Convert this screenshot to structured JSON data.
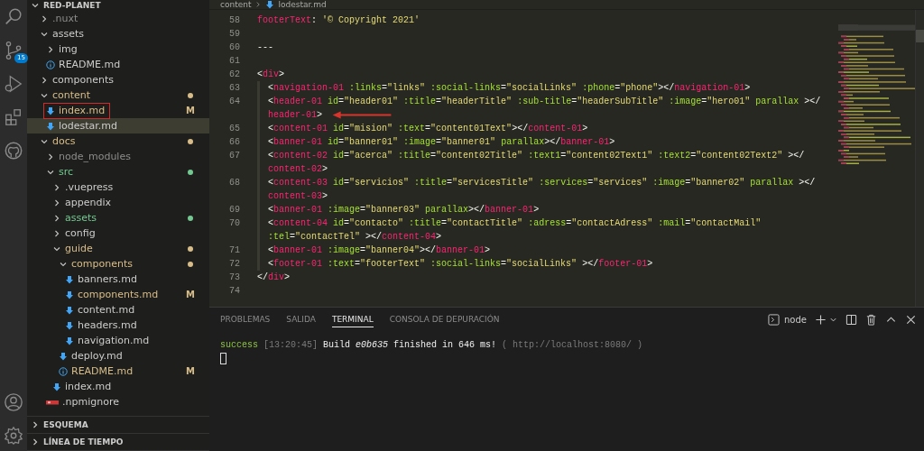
{
  "activity_bar": {
    "badge": "15"
  },
  "sidebar": {
    "title": "RED-PLANET",
    "tree": [
      {
        "name": ".nuxt",
        "kind": "folder",
        "expanded": false,
        "color": "#8c8c8c",
        "dot": false,
        "selected": false
      },
      {
        "name": "assets",
        "kind": "folder",
        "expanded": true,
        "color": "#cccccc",
        "dot": false,
        "selected": false,
        "children": [
          {
            "name": "img",
            "kind": "folder",
            "expanded": false,
            "color": "#cccccc",
            "dot": false,
            "selected": false
          },
          {
            "name": "README.md",
            "kind": "info",
            "color": "#cccccc",
            "selected": false
          }
        ]
      },
      {
        "name": "components",
        "kind": "folder",
        "expanded": false,
        "color": "#cccccc",
        "dot": false,
        "selected": false
      },
      {
        "name": "content",
        "kind": "folder",
        "expanded": true,
        "color": "#d8bd8a",
        "dot": true,
        "selected": false,
        "children": [
          {
            "name": "index.md",
            "kind": "markdown",
            "color": "#d8bd8a",
            "badge": "M",
            "marked": true,
            "selected": false
          },
          {
            "name": "lodestar.md",
            "kind": "markdown",
            "color": "#cccccc",
            "selected": true
          }
        ]
      },
      {
        "name": "docs",
        "kind": "folder",
        "expanded": true,
        "color": "#d8bd8a",
        "dot": true,
        "selected": false,
        "children": [
          {
            "name": "node_modules",
            "kind": "folder",
            "expanded": false,
            "color": "#8c8c8c",
            "dot": false,
            "selected": false
          },
          {
            "name": "src",
            "kind": "folder",
            "expanded": true,
            "color": "#73c991",
            "dot": true,
            "selected": false,
            "children": [
              {
                "name": ".vuepress",
                "kind": "folder",
                "expanded": false,
                "color": "#cccccc",
                "dot": false,
                "selected": false
              },
              {
                "name": "appendix",
                "kind": "folder",
                "expanded": false,
                "color": "#cccccc",
                "dot": false,
                "selected": false
              },
              {
                "name": "assets",
                "kind": "folder",
                "expanded": false,
                "color": "#73c991",
                "dot": true,
                "selected": false
              },
              {
                "name": "config",
                "kind": "folder",
                "expanded": false,
                "color": "#cccccc",
                "dot": false,
                "selected": false
              },
              {
                "name": "guide",
                "kind": "folder",
                "expanded": true,
                "color": "#d8bd8a",
                "dot": true,
                "selected": false,
                "children": [
                  {
                    "name": "components",
                    "kind": "folder",
                    "expanded": true,
                    "color": "#d8bd8a",
                    "dot": true,
                    "selected": false,
                    "children": [
                      {
                        "name": "banners.md",
                        "kind": "markdown",
                        "color": "#cccccc",
                        "selected": false
                      },
                      {
                        "name": "components.md",
                        "kind": "markdown",
                        "color": "#d8bd8a",
                        "badge": "M",
                        "selected": false
                      },
                      {
                        "name": "content.md",
                        "kind": "markdown",
                        "color": "#cccccc",
                        "selected": false
                      },
                      {
                        "name": "headers.md",
                        "kind": "markdown",
                        "color": "#cccccc",
                        "selected": false
                      },
                      {
                        "name": "navigation.md",
                        "kind": "markdown",
                        "color": "#cccccc",
                        "selected": false
                      }
                    ]
                  },
                  {
                    "name": "deploy.md",
                    "kind": "markdown",
                    "color": "#cccccc",
                    "selected": false
                  },
                  {
                    "name": "README.md",
                    "kind": "info",
                    "color": "#d8bd8a",
                    "badge": "M",
                    "selected": false
                  }
                ]
              },
              {
                "name": "index.md",
                "kind": "markdown",
                "color": "#cccccc",
                "selected": false
              }
            ]
          },
          {
            "name": ".npmignore",
            "kind": "npm",
            "color": "#cccccc",
            "selected": false
          }
        ]
      }
    ],
    "sections": [
      {
        "label": "ESQUEMA",
        "expanded": false
      },
      {
        "label": "LÍNEA DE TIEMPO",
        "expanded": false
      }
    ]
  },
  "editor": {
    "breadcrumb": [
      "content",
      "lodestar.md"
    ],
    "lines": [
      {
        "number": "58",
        "indented": false,
        "tokens": [
          {
            "kind": "key",
            "text": "footerText"
          },
          {
            "kind": "punct",
            "text": ": "
          },
          {
            "kind": "string",
            "text": "'© Copyright 2021'"
          }
        ]
      },
      {
        "number": "59",
        "indented": false
      },
      {
        "number": "60",
        "indented": false,
        "tokens": [
          {
            "kind": "punct",
            "text": "---"
          }
        ]
      },
      {
        "number": "61",
        "indented": false
      },
      {
        "number": "62",
        "indented": false,
        "tokens": [
          {
            "kind": "punct",
            "text": "<"
          },
          {
            "kind": "tag",
            "text": "div"
          },
          {
            "kind": "punct",
            "text": ">"
          }
        ]
      },
      {
        "number": "63",
        "indented": true,
        "tokens": [
          {
            "kind": "punct",
            "text": "<"
          },
          {
            "kind": "tag",
            "text": "navigation-01"
          },
          {
            "kind": "attr",
            "text": " :links"
          },
          {
            "kind": "punct",
            "text": "="
          },
          {
            "kind": "string",
            "text": "\"links\""
          },
          {
            "kind": "attr",
            "text": " :social-links"
          },
          {
            "kind": "punct",
            "text": "="
          },
          {
            "kind": "string",
            "text": "\"socialLinks\""
          },
          {
            "kind": "attr",
            "text": " :phone"
          },
          {
            "kind": "punct",
            "text": "="
          },
          {
            "kind": "string",
            "text": "\"phone\""
          },
          {
            "kind": "punct",
            "text": "></"
          },
          {
            "kind": "tag",
            "text": "navigation-01"
          },
          {
            "kind": "punct",
            "text": ">"
          }
        ]
      },
      {
        "number": "64",
        "indented": true,
        "tokens": [
          {
            "kind": "punct",
            "text": "<"
          },
          {
            "kind": "tag",
            "text": "header-01"
          },
          {
            "kind": "attr",
            "text": " id"
          },
          {
            "kind": "punct",
            "text": "="
          },
          {
            "kind": "string",
            "text": "\"header01\""
          },
          {
            "kind": "attr",
            "text": " :title"
          },
          {
            "kind": "punct",
            "text": "="
          },
          {
            "kind": "string",
            "text": "\"headerTitle\""
          },
          {
            "kind": "attr",
            "text": " :sub-title"
          },
          {
            "kind": "punct",
            "text": "="
          },
          {
            "kind": "string",
            "text": "\"headerSubTitle\""
          },
          {
            "kind": "attr",
            "text": " :image"
          },
          {
            "kind": "punct",
            "text": "="
          },
          {
            "kind": "string",
            "text": "\"hero01\""
          },
          {
            "kind": "attr",
            "text": " parallax"
          },
          {
            "kind": "punct",
            "text": " ></"
          }
        ]
      },
      {
        "indented": true,
        "marked": true,
        "tokens": [
          {
            "kind": "tag",
            "text": "header-01"
          },
          {
            "kind": "punct",
            "text": ">"
          }
        ]
      },
      {
        "number": "65",
        "indented": true,
        "tokens": [
          {
            "kind": "punct",
            "text": "<"
          },
          {
            "kind": "tag",
            "text": "content-01"
          },
          {
            "kind": "attr",
            "text": " id"
          },
          {
            "kind": "punct",
            "text": "="
          },
          {
            "kind": "string",
            "text": "\"mision\""
          },
          {
            "kind": "attr",
            "text": " :text"
          },
          {
            "kind": "punct",
            "text": "="
          },
          {
            "kind": "string",
            "text": "\"content01Text\""
          },
          {
            "kind": "punct",
            "text": "></"
          },
          {
            "kind": "tag",
            "text": "content-01"
          },
          {
            "kind": "punct",
            "text": ">"
          }
        ]
      },
      {
        "number": "66",
        "indented": true,
        "tokens": [
          {
            "kind": "punct",
            "text": "<"
          },
          {
            "kind": "tag",
            "text": "banner-01"
          },
          {
            "kind": "attr",
            "text": " id"
          },
          {
            "kind": "punct",
            "text": "="
          },
          {
            "kind": "string",
            "text": "\"banner01\""
          },
          {
            "kind": "attr",
            "text": " :image"
          },
          {
            "kind": "punct",
            "text": "="
          },
          {
            "kind": "string",
            "text": "\"banner01\""
          },
          {
            "kind": "attr",
            "text": " parallax"
          },
          {
            "kind": "punct",
            "text": "></"
          },
          {
            "kind": "tag",
            "text": "banner-01"
          },
          {
            "kind": "punct",
            "text": ">"
          }
        ]
      },
      {
        "number": "67",
        "indented": true,
        "tokens": [
          {
            "kind": "punct",
            "text": "<"
          },
          {
            "kind": "tag",
            "text": "content-02"
          },
          {
            "kind": "attr",
            "text": " id"
          },
          {
            "kind": "punct",
            "text": "="
          },
          {
            "kind": "string",
            "text": "\"acerca\""
          },
          {
            "kind": "attr",
            "text": " :title"
          },
          {
            "kind": "punct",
            "text": "="
          },
          {
            "kind": "string",
            "text": "\"content02Title\""
          },
          {
            "kind": "attr",
            "text": " :text1"
          },
          {
            "kind": "punct",
            "text": "="
          },
          {
            "kind": "string",
            "text": "\"content02Text1\""
          },
          {
            "kind": "attr",
            "text": " :text2"
          },
          {
            "kind": "punct",
            "text": "="
          },
          {
            "kind": "string",
            "text": "\"content02Text2\""
          },
          {
            "kind": "punct",
            "text": " ></"
          }
        ]
      },
      {
        "indented": true,
        "tokens": [
          {
            "kind": "tag",
            "text": "content-02"
          },
          {
            "kind": "punct",
            "text": ">"
          }
        ]
      },
      {
        "number": "68",
        "indented": true,
        "tokens": [
          {
            "kind": "punct",
            "text": "<"
          },
          {
            "kind": "tag",
            "text": "content-03"
          },
          {
            "kind": "attr",
            "text": " id"
          },
          {
            "kind": "punct",
            "text": "="
          },
          {
            "kind": "string",
            "text": "\"servicios\""
          },
          {
            "kind": "attr",
            "text": " :title"
          },
          {
            "kind": "punct",
            "text": "="
          },
          {
            "kind": "string",
            "text": "\"servicesTitle\""
          },
          {
            "kind": "attr",
            "text": " :services"
          },
          {
            "kind": "punct",
            "text": "="
          },
          {
            "kind": "string",
            "text": "\"services\""
          },
          {
            "kind": "attr",
            "text": " :image"
          },
          {
            "kind": "punct",
            "text": "="
          },
          {
            "kind": "string",
            "text": "\"banner02\""
          },
          {
            "kind": "attr",
            "text": " parallax"
          },
          {
            "kind": "punct",
            "text": " ></"
          }
        ]
      },
      {
        "indented": true,
        "tokens": [
          {
            "kind": "tag",
            "text": "content-03"
          },
          {
            "kind": "punct",
            "text": ">"
          }
        ]
      },
      {
        "number": "69",
        "indented": true,
        "tokens": [
          {
            "kind": "punct",
            "text": "<"
          },
          {
            "kind": "tag",
            "text": "banner-01"
          },
          {
            "kind": "attr",
            "text": " :image"
          },
          {
            "kind": "punct",
            "text": "="
          },
          {
            "kind": "string",
            "text": "\"banner03\""
          },
          {
            "kind": "attr",
            "text": " parallax"
          },
          {
            "kind": "punct",
            "text": "></"
          },
          {
            "kind": "tag",
            "text": "banner-01"
          },
          {
            "kind": "punct",
            "text": ">"
          }
        ]
      },
      {
        "number": "70",
        "indented": true,
        "tokens": [
          {
            "kind": "punct",
            "text": "<"
          },
          {
            "kind": "tag",
            "text": "content-04"
          },
          {
            "kind": "attr",
            "text": " id"
          },
          {
            "kind": "punct",
            "text": "="
          },
          {
            "kind": "string",
            "text": "\"contacto\""
          },
          {
            "kind": "attr",
            "text": " :title"
          },
          {
            "kind": "punct",
            "text": "="
          },
          {
            "kind": "string",
            "text": "\"contactTitle\""
          },
          {
            "kind": "attr",
            "text": " :adress"
          },
          {
            "kind": "punct",
            "text": "="
          },
          {
            "kind": "string",
            "text": "\"contactAdress\""
          },
          {
            "kind": "attr",
            "text": " :mail"
          },
          {
            "kind": "punct",
            "text": "="
          },
          {
            "kind": "string",
            "text": "\"contactMail\""
          }
        ]
      },
      {
        "indented": true,
        "tokens": [
          {
            "kind": "attr",
            "text": ":tel"
          },
          {
            "kind": "punct",
            "text": "="
          },
          {
            "kind": "string",
            "text": "\"contactTel\""
          },
          {
            "kind": "punct",
            "text": " ></"
          },
          {
            "kind": "tag",
            "text": "content-04"
          },
          {
            "kind": "punct",
            "text": ">"
          }
        ]
      },
      {
        "number": "71",
        "indented": true,
        "tokens": [
          {
            "kind": "punct",
            "text": "<"
          },
          {
            "kind": "tag",
            "text": "banner-01"
          },
          {
            "kind": "attr",
            "text": " :image"
          },
          {
            "kind": "punct",
            "text": "="
          },
          {
            "kind": "string",
            "text": "\"banner04\""
          },
          {
            "kind": "punct",
            "text": "></"
          },
          {
            "kind": "tag",
            "text": "banner-01"
          },
          {
            "kind": "punct",
            "text": ">"
          }
        ]
      },
      {
        "number": "72",
        "indented": true,
        "tokens": [
          {
            "kind": "punct",
            "text": "<"
          },
          {
            "kind": "tag",
            "text": "footer-01"
          },
          {
            "kind": "attr",
            "text": " :text"
          },
          {
            "kind": "punct",
            "text": "="
          },
          {
            "kind": "string",
            "text": "\"footerText\""
          },
          {
            "kind": "attr",
            "text": " :social-links"
          },
          {
            "kind": "punct",
            "text": "="
          },
          {
            "kind": "string",
            "text": "\"socialLinks\""
          },
          {
            "kind": "punct",
            "text": " ></"
          },
          {
            "kind": "tag",
            "text": "footer-01"
          },
          {
            "kind": "punct",
            "text": ">"
          }
        ]
      },
      {
        "number": "73",
        "indented": false,
        "tokens": [
          {
            "kind": "punct",
            "text": "</"
          },
          {
            "kind": "tag",
            "text": "div"
          },
          {
            "kind": "punct",
            "text": ">"
          }
        ]
      },
      {
        "number": "74",
        "indented": false
      }
    ]
  },
  "panel": {
    "tabs": [
      {
        "label": "PROBLEMAS",
        "selected": false
      },
      {
        "label": "SALIDA",
        "selected": false
      },
      {
        "label": "TERMINAL",
        "selected": true
      },
      {
        "label": "CONSOLA DE DEPURACIÓN",
        "selected": false
      }
    ],
    "shell": "node",
    "output": [
      {
        "kind": "success",
        "text": "success"
      },
      {
        "kind": "dim",
        "text": " [13:20:45]"
      },
      {
        "kind": "plain",
        "text": " Build "
      },
      {
        "kind": "italic",
        "text": "e0b635"
      },
      {
        "kind": "plain",
        "text": " finished in 646 ms! "
      },
      {
        "kind": "dim",
        "text": "( http://localhost:8080/ )"
      }
    ]
  }
}
